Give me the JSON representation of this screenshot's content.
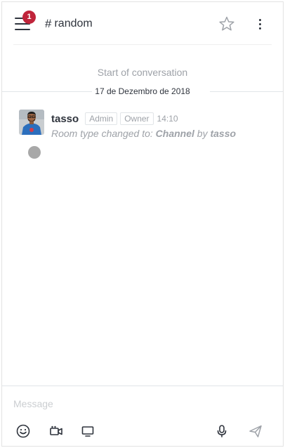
{
  "header": {
    "menu_badge": "1",
    "room_hash": "#",
    "room_name": "random",
    "icons": [
      "menu-icon",
      "star-icon",
      "kebab-icon"
    ]
  },
  "conversation": {
    "start_text": "Start of conversation",
    "date_separator": "17 de Dezembro de 2018",
    "messages": [
      {
        "username": "tasso",
        "roles": [
          "Admin",
          "Owner"
        ],
        "time": "14:10",
        "text_prefix": "Room type changed to: ",
        "text_value": "Channel",
        "text_middle": " by ",
        "text_user": "tasso"
      }
    ]
  },
  "composer": {
    "placeholder": "Message",
    "value": "",
    "icons": [
      "emoji-icon",
      "video-icon",
      "screen-share-icon",
      "microphone-icon",
      "send-icon"
    ]
  },
  "colors": {
    "badge": "#c0243a",
    "text_primary": "#2f343d",
    "text_secondary": "#9ea2a8"
  }
}
